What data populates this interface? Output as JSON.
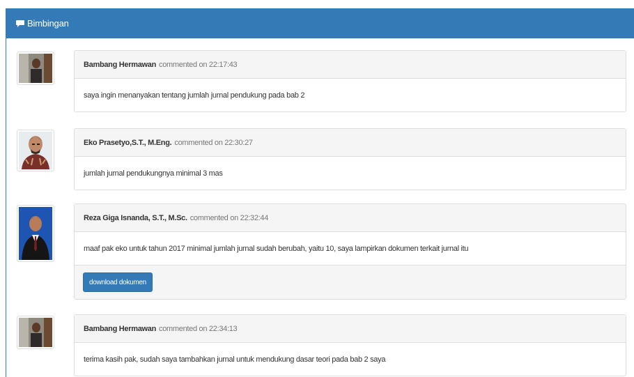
{
  "panel": {
    "title": "Bimbingan",
    "icon": "comment-icon",
    "accent": "#337ab7"
  },
  "comments": [
    {
      "author": "Bambang Hermawan",
      "meta": "commented on 22:17:43",
      "text": "saya ingin menanyakan tentang jumlah jurnal pendukung pada bab 2"
    },
    {
      "author": "Eko Prasetyo,S.T., M.Eng.",
      "meta": "commented on 22:30:27",
      "text": "jumlah jurnal pendukungnya minimal 3 mas"
    },
    {
      "author": "Reza Giga Isnanda, S.T., M.Sc.",
      "meta": "commented on 22:32:44",
      "text": "maaf pak eko untuk tahun 2017 minimal jumlah jurnal sudah berubah, yaitu 10, saya lampirkan dokumen terkait jurnal itu",
      "button": "download dokumen"
    },
    {
      "author": "Bambang Hermawan",
      "meta": "commented on 22:34:13",
      "text": "terima kasih pak, sudah saya tambahkan jurnal untuk mendukung dasar teori pada bab 2 saya"
    }
  ]
}
